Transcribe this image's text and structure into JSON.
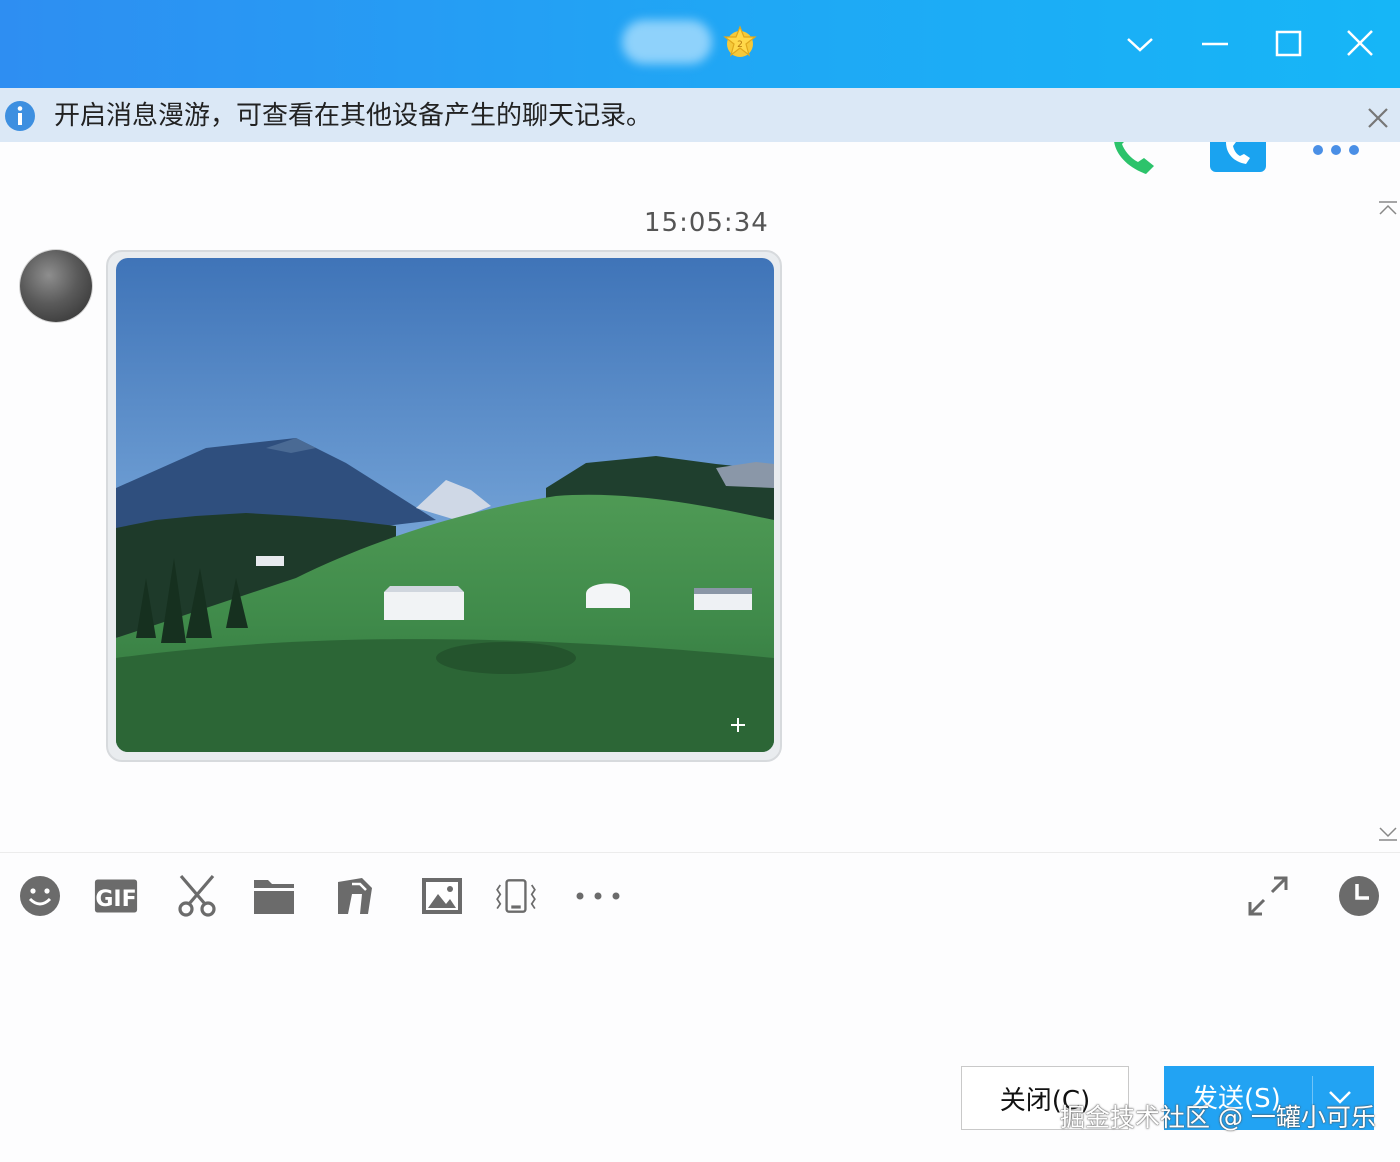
{
  "titlebar": {
    "icons": [
      "star-badge-icon",
      "chevron-down-icon",
      "minimize-icon",
      "maximize-icon",
      "close-icon"
    ]
  },
  "notice": {
    "text": "开启消息漫游，可查看在其他设备产生的聊天记录。",
    "icons": [
      "info-icon",
      "close-icon"
    ]
  },
  "header_actions": [
    "voice-call-icon",
    "video-call-icon",
    "more-icon"
  ],
  "chat": {
    "timestamp": "15:05:34",
    "messages": [
      {
        "type": "image",
        "sender": "avatar",
        "description_icon": "photo"
      }
    ]
  },
  "toolbar": {
    "left_icons": [
      "emoji-icon",
      "gif-icon",
      "screenshot-scissors-icon",
      "folder-icon",
      "file-transfer-icon",
      "image-icon",
      "shake-icon",
      "more-dots-icon"
    ],
    "right_icons": [
      "expand-icon",
      "history-clock-icon"
    ],
    "gif_label": "GIF"
  },
  "buttons": {
    "close_label": "关闭(C)",
    "send_label": "发送(S)"
  },
  "watermark": "掘金技术社区 @ 一罐小可乐",
  "colors": {
    "titlebar_start": "#2e8ef2",
    "titlebar_end": "#16b6f7",
    "notice_bg": "#dbe8f6",
    "send_button": "#22a3f3",
    "call_green": "#2cc36b",
    "video_blue": "#1aa3f0"
  }
}
